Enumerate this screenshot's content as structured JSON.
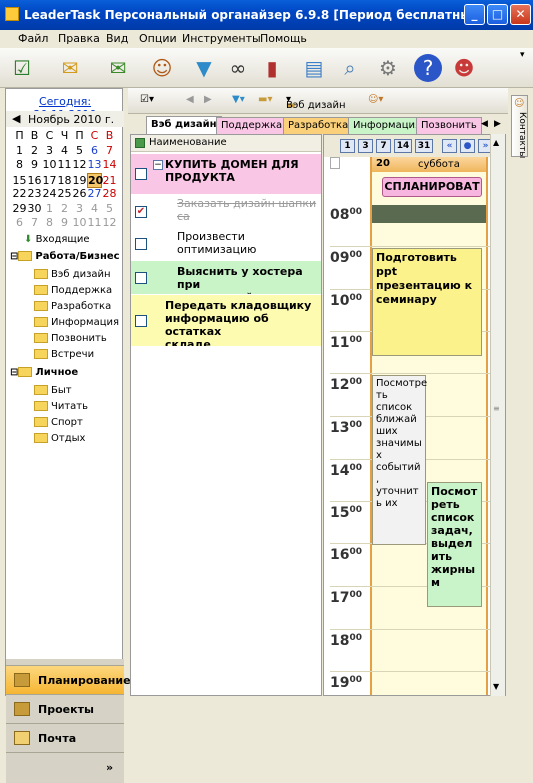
{
  "window": {
    "title": "LeaderTask Персональный органайзер 6.9.8 [Период бесплатных обнов..."
  },
  "menu": [
    "Файл",
    "Правка",
    "Вид",
    "Опции",
    "Инструменты",
    "Помощь"
  ],
  "toolbar_icons": [
    "new-task-icon",
    "mail-icon",
    "send-mail-icon",
    "contacts-icon",
    "filter-icon",
    "binoculars-icon",
    "bottles-icon",
    "print-icon",
    "preview-icon",
    "settings-icon",
    "help-icon",
    "people-icon"
  ],
  "left": {
    "today": "Сегодня: 20.11.2010",
    "month": "Ноябрь 2010 г.",
    "weekdays": [
      "П",
      "В",
      "С",
      "Ч",
      "П",
      "С",
      "В"
    ],
    "weeks": [
      [
        "1",
        "2",
        "3",
        "4",
        "5",
        "6",
        "7"
      ],
      [
        "8",
        "9",
        "10",
        "11",
        "12",
        "13",
        "14"
      ],
      [
        "15",
        "16",
        "17",
        "18",
        "19",
        "20",
        "21"
      ],
      [
        "22",
        "23",
        "24",
        "25",
        "26",
        "27",
        "28"
      ],
      [
        "29",
        "30",
        "1",
        "2",
        "3",
        "4",
        "5"
      ],
      [
        "6",
        "7",
        "8",
        "9",
        "10",
        "11",
        "12"
      ]
    ],
    "tree": {
      "inbox": "Входящие",
      "work": "Работа/Бизнес",
      "work_items": [
        "Вэб дизайн",
        "Поддержка",
        "Разработка",
        "Информация",
        "Позвонить",
        "Встречи"
      ],
      "personal": "Личное",
      "personal_items": [
        "Быт",
        "Читать",
        "Спорт",
        "Отдых"
      ]
    },
    "nav": [
      "Планирование",
      "Проекты",
      "Почта"
    ]
  },
  "subtoolbar": {
    "filter_label": "Вэб дизайн"
  },
  "tabs": [
    "Вэб дизайн",
    "Поддержка",
    "Разработка",
    "Информация",
    "Позвонить"
  ],
  "tasks": {
    "column": "Наименование",
    "items": [
      {
        "text": "КУПИТЬ ДОМЕН ДЛЯ\nПРОДУКТА",
        "bold": true,
        "bg": "#f9c6e6",
        "checked": false,
        "done": false
      },
      {
        "text": "Заказать дизайн шапки са\n(логотип программы + сло",
        "bold": false,
        "bg": "#ffffff",
        "checked": true,
        "done": true
      },
      {
        "text": "Произвести оптимизацию\nпод ключевые слова (SEO",
        "bold": false,
        "bg": "#ffffff",
        "checked": false,
        "done": false
      },
      {
        "text": "Выяснить у хостера при\nпростоя сайта",
        "bold": true,
        "bg": "#c8f4c8",
        "checked": false,
        "done": false
      },
      {
        "text": "Передать кладовщику\nинформацию об остатках\nскладе",
        "bold": true,
        "bg": "#fdfbb0",
        "checked": false,
        "done": false
      }
    ]
  },
  "calendar": {
    "views": [
      "1",
      "3",
      "7",
      "14",
      "31"
    ],
    "day_num": "20",
    "day_name": "суббота",
    "planned": "СПЛАНИРОВАТ",
    "hours": [
      "08",
      "09",
      "10",
      "11",
      "12",
      "13",
      "14",
      "15",
      "16",
      "17",
      "18",
      "19"
    ],
    "appointments": [
      {
        "text": "Подготовить ppt презентацию к семинару",
        "color": "#fbf28c"
      },
      {
        "text": "Посмотре\nть\nсписок\nближай\nших\nзначимы\nх\nсобытий\n,\nуточнит\nь их",
        "color": "#f2f2f2"
      },
      {
        "text": "Посмот\nреть\nсписок\nзадач,\nвыдел\nить\nжирны\nм",
        "color": "#c9f3c9"
      }
    ]
  },
  "side": {
    "contacts": "Контакты"
  }
}
